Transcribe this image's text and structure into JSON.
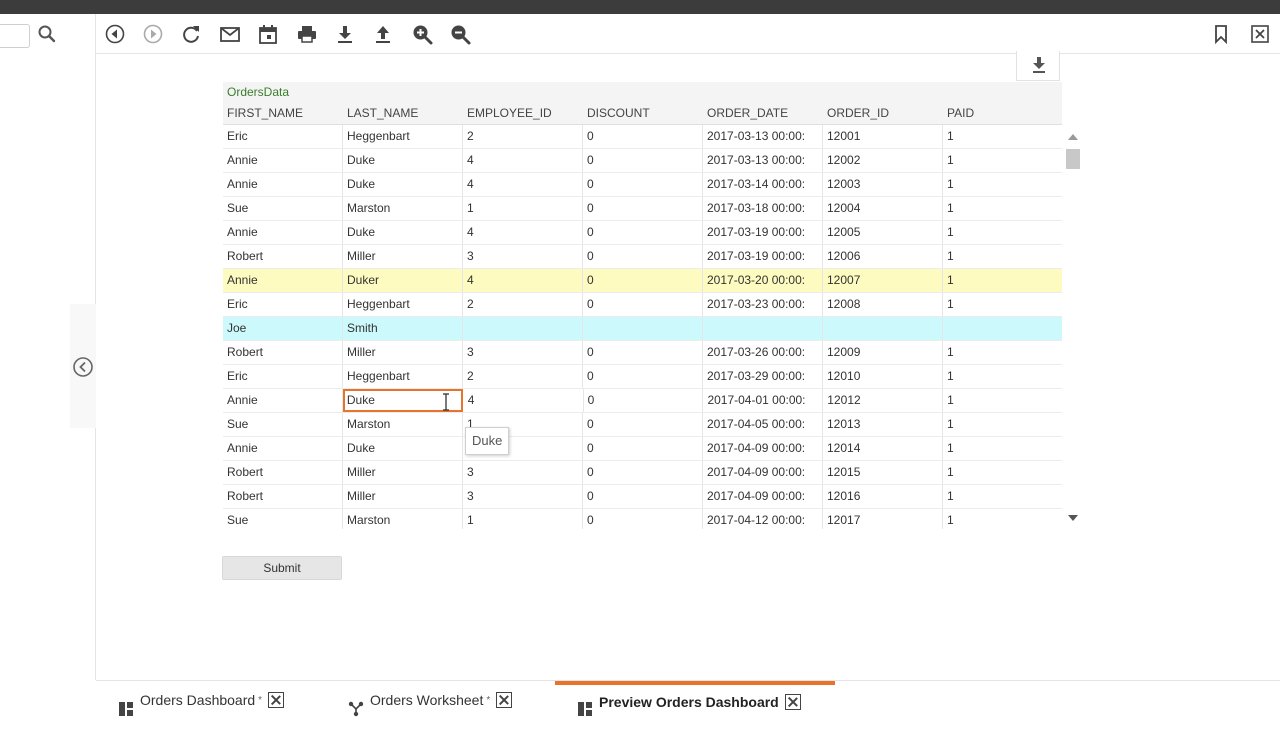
{
  "colors": {
    "accent": "#e8742b",
    "title_green": "#3a7d2a",
    "modified_row": "#fdfbc0",
    "inserted_row": "#ccf9fb"
  },
  "toolbar": {
    "icons": [
      "back-icon",
      "forward-icon",
      "refresh-icon",
      "email-icon",
      "calendar-icon",
      "print-icon",
      "download-icon",
      "upload-icon",
      "zoom-in-icon",
      "zoom-out-icon",
      "bookmark-icon",
      "close-icon"
    ]
  },
  "grid": {
    "title": "OrdersData",
    "columns": [
      "FIRST_NAME",
      "LAST_NAME",
      "EMPLOYEE_ID",
      "DISCOUNT",
      "ORDER_DATE",
      "ORDER_ID",
      "PAID"
    ],
    "rows": [
      {
        "state": "normal",
        "cells": [
          "Eric",
          "Heggenbart",
          "2",
          "0",
          "2017-03-13 00:00:",
          "12001",
          "1"
        ]
      },
      {
        "state": "normal",
        "cells": [
          "Annie",
          "Duke",
          "4",
          "0",
          "2017-03-13 00:00:",
          "12002",
          "1"
        ]
      },
      {
        "state": "normal",
        "cells": [
          "Annie",
          "Duke",
          "4",
          "0",
          "2017-03-14 00:00:",
          "12003",
          "1"
        ]
      },
      {
        "state": "normal",
        "cells": [
          "Sue",
          "Marston",
          "1",
          "0",
          "2017-03-18 00:00:",
          "12004",
          "1"
        ]
      },
      {
        "state": "normal",
        "cells": [
          "Annie",
          "Duke",
          "4",
          "0",
          "2017-03-19 00:00:",
          "12005",
          "1"
        ]
      },
      {
        "state": "normal",
        "cells": [
          "Robert",
          "Miller",
          "3",
          "0",
          "2017-03-19 00:00:",
          "12006",
          "1"
        ]
      },
      {
        "state": "modified",
        "cells": [
          "Annie",
          "Duker",
          "4",
          "0",
          "2017-03-20 00:00:",
          "12007",
          "1"
        ]
      },
      {
        "state": "normal",
        "cells": [
          "Eric",
          "Heggenbart",
          "2",
          "0",
          "2017-03-23 00:00:",
          "12008",
          "1"
        ]
      },
      {
        "state": "inserted",
        "cells": [
          "Joe",
          "Smith",
          "",
          "",
          "",
          "",
          ""
        ]
      },
      {
        "state": "normal",
        "cells": [
          "Robert",
          "Miller",
          "3",
          "0",
          "2017-03-26 00:00:",
          "12009",
          "1"
        ]
      },
      {
        "state": "normal",
        "cells": [
          "Eric",
          "Heggenbart",
          "2",
          "0",
          "2017-03-29 00:00:",
          "12010",
          "1"
        ]
      },
      {
        "state": "editing",
        "cells": [
          "Annie",
          "Duke",
          "4",
          "0",
          "2017-04-01 00:00:",
          "12012",
          "1"
        ]
      },
      {
        "state": "normal",
        "cells": [
          "Sue",
          "Marston",
          "1",
          "0",
          "2017-04-05 00:00:",
          "12013",
          "1"
        ]
      },
      {
        "state": "normal",
        "cells": [
          "Annie",
          "Duke",
          "",
          "0",
          "2017-04-09 00:00:",
          "12014",
          "1"
        ]
      },
      {
        "state": "normal",
        "cells": [
          "Robert",
          "Miller",
          "3",
          "0",
          "2017-04-09 00:00:",
          "12015",
          "1"
        ]
      },
      {
        "state": "normal",
        "cells": [
          "Robert",
          "Miller",
          "3",
          "0",
          "2017-04-09 00:00:",
          "12016",
          "1"
        ]
      },
      {
        "state": "normal",
        "cells": [
          "Sue",
          "Marston",
          "1",
          "0",
          "2017-04-12 00:00:",
          "12017",
          "1"
        ]
      }
    ],
    "tooltip": "Duke"
  },
  "submit_label": "Submit",
  "tabs": [
    {
      "label": "Orders Dashboard",
      "modified_mark": "*",
      "icon": "dashboard-icon",
      "active": false
    },
    {
      "label": "Orders Worksheet",
      "modified_mark": "*",
      "icon": "worksheet-icon",
      "active": false
    },
    {
      "label": "Preview Orders Dashboard",
      "modified_mark": "",
      "icon": "dashboard-icon",
      "active": true
    }
  ]
}
